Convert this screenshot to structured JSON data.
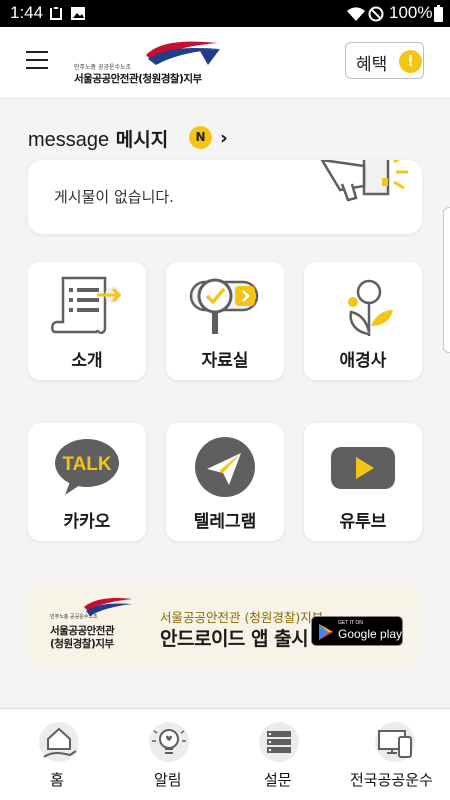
{
  "status_bar": {
    "time": "1:44",
    "battery": "100%"
  },
  "header": {
    "logo_small": "민주노총 공공운수노조",
    "logo_big": "서울공공안전관(청원경찰)지부",
    "benefit_label": "혜택",
    "benefit_alert": "!"
  },
  "message": {
    "title_en": "message",
    "title_ko": "메시지",
    "badge": "N",
    "more": "›",
    "empty_text": "게시물이 없습니다."
  },
  "tiles": [
    {
      "label": "소개",
      "icon": "document-arrow-icon"
    },
    {
      "label": "자료실",
      "icon": "magnifier-check-icon"
    },
    {
      "label": "애경사",
      "icon": "flower-icon"
    },
    {
      "label": "카카오",
      "icon": "kakao-talk-icon"
    },
    {
      "label": "텔레그램",
      "icon": "telegram-icon"
    },
    {
      "label": "유투브",
      "icon": "youtube-icon"
    }
  ],
  "banner": {
    "logo_small": "민주노총 공공운수노조",
    "logo_line1": "서울공공안전관",
    "logo_line2": "(청원경찰)지부",
    "line1": "서울공공안전관 (청원경찰)지부",
    "line2": "안드로이드 앱 출시",
    "store_small": "GET IT ON",
    "store_big": "Google play"
  },
  "bottom_nav": [
    {
      "label": "홈",
      "icon": "home-hand-icon"
    },
    {
      "label": "알림",
      "icon": "lightbulb-icon"
    },
    {
      "label": "설문",
      "icon": "survey-list-icon"
    },
    {
      "label": "전국공공운수",
      "icon": "devices-icon"
    }
  ],
  "colors": {
    "accent": "#f5c516",
    "icon_gray": "#5f5f5f",
    "background": "#f4f4f4"
  }
}
